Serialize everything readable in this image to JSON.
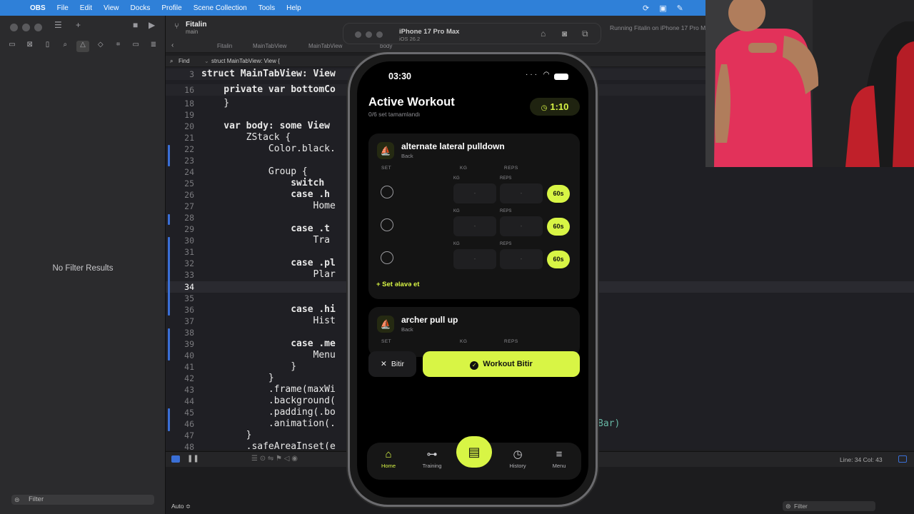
{
  "menubar": {
    "app": "OBS",
    "items": [
      "File",
      "Edit",
      "View",
      "Docks",
      "Profile",
      "Scene Collection",
      "Tools",
      "Help"
    ]
  },
  "xcode": {
    "scheme_title": "Fitalin",
    "scheme_branch": "main",
    "running_status": "Running Fitalin on iPhone 17 Pro Max",
    "jump_bar": [
      "Fitalin",
      "MainTabView",
      "MainTabView",
      "body"
    ],
    "find_label": "Find",
    "find_context": "struct MainTabView: View {",
    "sidebar_empty": "No Filter Results",
    "sidebar_filter": "Filter",
    "console_mode": "Auto ≎",
    "console_filter": "Filter",
    "cursor_position": "Line: 34  Col: 43",
    "lines": [
      {
        "n": "3",
        "code": "struct MainTabView: View"
      },
      {
        "n": "16",
        "code": "    private var bottomCo"
      },
      {
        "n": "18",
        "code": "    }"
      },
      {
        "n": "19",
        "code": ""
      },
      {
        "n": "20",
        "code": "    var body: some View"
      },
      {
        "n": "21",
        "code": "        ZStack {"
      },
      {
        "n": "22",
        "code": "            Color.black."
      },
      {
        "n": "23",
        "code": ""
      },
      {
        "n": "24",
        "code": "            Group {"
      },
      {
        "n": "25",
        "code": "                switch"
      },
      {
        "n": "26",
        "code": "                case .h"
      },
      {
        "n": "27",
        "code": "                    Home"
      },
      {
        "n": "28",
        "code": ""
      },
      {
        "n": "29",
        "code": "                case .t"
      },
      {
        "n": "30",
        "code": "                    Tra"
      },
      {
        "n": "31",
        "code": ""
      },
      {
        "n": "32",
        "code": "                case .pl"
      },
      {
        "n": "33",
        "code": "                    Plar"
      },
      {
        "n": "34",
        "code": ""
      },
      {
        "n": "35",
        "code": ""
      },
      {
        "n": "36",
        "code": "                case .hi"
      },
      {
        "n": "37",
        "code": "                    Hist"
      },
      {
        "n": "38",
        "code": ""
      },
      {
        "n": "39",
        "code": "                case .me"
      },
      {
        "n": "40",
        "code": "                    Menu"
      },
      {
        "n": "41",
        "code": "                }"
      },
      {
        "n": "42",
        "code": "            }"
      },
      {
        "n": "43",
        "code": "            .frame(maxWi"
      },
      {
        "n": "44",
        "code": "            .background("
      },
      {
        "n": "45",
        "code": "            .padding(.bo"
      },
      {
        "n": "46",
        "code": "            .animation(."
      },
      {
        "n": "47",
        "code": "        }"
      },
      {
        "n": "48",
        "code": "        .safeAreaInset(e"
      }
    ],
    "code_tail_46": "Bar)"
  },
  "simulator": {
    "device": "iPhone 17 Pro Max",
    "os": "iOS 26.2"
  },
  "app": {
    "status_time": "03:30",
    "title": "Active Workout",
    "subtitle": "0/6 set tamamlandı",
    "timer": "1:10",
    "col_set": "SET",
    "col_kg": "KG",
    "col_reps": "REPS",
    "exercises": [
      {
        "name": "alternate lateral pulldown",
        "muscle": "Back",
        "sets": [
          {
            "rest": "60s"
          },
          {
            "rest": "60s"
          },
          {
            "rest": "60s"
          }
        ]
      },
      {
        "name": "archer pull up",
        "muscle": "Back"
      }
    ],
    "add_set": "+ Set əlavə et",
    "cancel_button": "Bitir",
    "finish_button": "Workout Bitir",
    "tabs": [
      {
        "label": "Home",
        "icon": "home-icon",
        "active": true
      },
      {
        "label": "Training",
        "icon": "dumbbell-icon"
      },
      {
        "label": "History",
        "icon": "history-icon"
      },
      {
        "label": "Menu",
        "icon": "menu-icon"
      }
    ]
  },
  "colors": {
    "accent": "#d8f545",
    "menubar": "#2f80d8",
    "keyword": "#ff7ab2"
  }
}
